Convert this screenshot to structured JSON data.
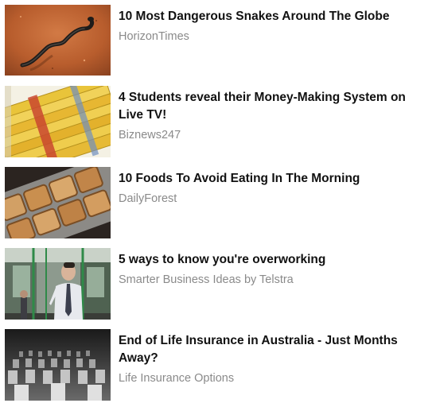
{
  "feed": {
    "items": [
      {
        "headline": "10 Most Dangerous Snakes Around The Globe",
        "source": "HorizonTimes",
        "image": "snake-on-sand-image"
      },
      {
        "headline": "4 Students reveal their Money-Making System on Live TV!",
        "source": "Biznews247",
        "image": "cash-stack-image"
      },
      {
        "headline": "10 Foods To Avoid Eating In The Morning",
        "source": "DailyForest",
        "image": "toast-tray-image"
      },
      {
        "headline": "5 ways to know you're overworking",
        "source": "Smarter Business Ideas by Telstra",
        "image": "commuter-train-image"
      },
      {
        "headline": "End of Life Insurance in Australia - Just Months Away?",
        "source": "Life Insurance Options",
        "image": "cemetery-image"
      }
    ]
  }
}
